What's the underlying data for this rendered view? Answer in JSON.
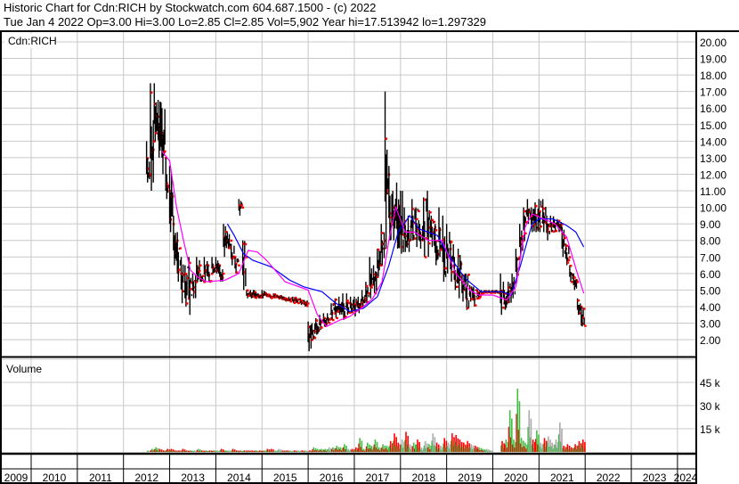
{
  "header": {
    "title": "Historic Chart for Cdn:RICH by Stockwatch.com 604.687.1500 - (c) 2022",
    "quote": "Tue Jan  4 2022  Op=3.00  Hi=3.00  Lo=2.85  Cl=2.85  Vol=5,902  Year hi=17.513942  lo=1.297329"
  },
  "price_panel": {
    "label": "Cdn:RICH"
  },
  "volume_panel": {
    "label": "Volume"
  },
  "colors": {
    "bar": "#000000",
    "close": "#ff0000",
    "ma_long": "#0000ff",
    "ma_short": "#ff00ff",
    "vol_up": "#44bb44",
    "vol_down": "#ff0000",
    "vol_flat": "#aaaaaa",
    "grid": "#c8c8c8"
  },
  "chart_data": {
    "type": "ohlc",
    "title": "Historic Chart for Cdn:RICH",
    "x_ticks": [
      "2009",
      "2010",
      "2011",
      "2012",
      "2013",
      "2014",
      "2015",
      "2016",
      "2017",
      "2018",
      "2019",
      "2020",
      "2021",
      "2022",
      "2023",
      "2024"
    ],
    "xlim": [
      2009.35,
      2024.4
    ],
    "y_ticks": [
      "20.00",
      "19.00",
      "18.00",
      "17.00",
      "16.00",
      "15.00",
      "14.00",
      "13.00",
      "12.00",
      "11.00",
      "10.00",
      "9.00",
      "8.00",
      "7.00",
      "6.00",
      "5.00",
      "4.00",
      "3.00",
      "2.00"
    ],
    "ylim": [
      1.0,
      20.6
    ],
    "volume_ticks": [
      "45 k",
      "30 k",
      "15 k"
    ],
    "volume_tick_values": [
      45,
      30,
      15
    ],
    "volume_unit": "thousands",
    "start": 2012.5,
    "step": "monthly",
    "high": [
      14,
      17.5,
      17.5,
      16.5,
      16,
      13,
      12.5,
      9.5,
      8.5,
      7,
      6.5,
      7,
      6,
      7,
      6,
      7,
      6.5,
      7,
      7,
      6.5,
      9,
      8.5,
      7.8,
      7,
      10.5,
      8,
      5,
      5,
      5,
      4.8,
      5,
      4.8,
      4.7,
      4.8,
      4.7,
      4.7,
      4.5,
      4.6,
      4.6,
      4.5,
      4.5,
      4.4,
      3.1,
      3,
      3.3,
      3.5,
      3.6,
      3.6,
      4.2,
      4.5,
      4.6,
      4.8,
      4.8,
      4.6,
      4.6,
      4.6,
      5,
      5.5,
      7,
      6.5,
      7.5,
      9,
      17,
      12.5,
      11,
      11.5,
      11,
      10,
      9.5,
      10.5,
      10,
      9,
      10.6,
      11,
      9.5,
      9,
      10,
      9.5,
      9,
      8,
      7,
      7.5,
      6,
      6,
      5.3,
      5.2,
      5,
      5,
      5,
      5,
      5,
      5,
      6,
      5,
      5.5,
      6,
      7.5,
      9,
      10,
      10.5,
      10,
      10.3,
      10.5,
      10.5,
      9.5,
      9.5,
      9.3,
      9.2,
      8.8,
      7.8,
      6.5,
      6,
      4.5,
      4
    ],
    "low": [
      11.5,
      11,
      14,
      13,
      12,
      10.5,
      8.5,
      6.5,
      5.5,
      4.2,
      4,
      3.5,
      4.5,
      5.5,
      5.5,
      5.5,
      5.5,
      6,
      6,
      5.5,
      7,
      7.5,
      6.5,
      6,
      9.5,
      5,
      4.5,
      4.5,
      4.5,
      4.5,
      4.5,
      4.6,
      4.5,
      4.5,
      4.5,
      4.4,
      4.3,
      4.3,
      4.2,
      4.2,
      4.1,
      4.0,
      1.3,
      2,
      2.3,
      2.6,
      2.8,
      3,
      3.2,
      3.3,
      3.5,
      3.2,
      3.5,
      3.6,
      3.4,
      3.6,
      4,
      4.2,
      4.5,
      4.8,
      5.8,
      6.5,
      7.5,
      8,
      8,
      7.5,
      7.2,
      7.3,
      7.3,
      8,
      7.6,
      7.5,
      7,
      7,
      7.6,
      6.5,
      7,
      5.5,
      6,
      5.5,
      5,
      4.5,
      4.3,
      3.8,
      4.3,
      4,
      4.5,
      4.8,
      4.8,
      4.8,
      4.8,
      4.8,
      3.5,
      3.8,
      4.2,
      4.5,
      5.5,
      7,
      8,
      9,
      8.5,
      8.5,
      8.5,
      8.5,
      8,
      8.5,
      8.5,
      8.5,
      7,
      6.5,
      5.5,
      5,
      3.5,
      2.8
    ],
    "close": [
      12,
      14,
      15.5,
      14.5,
      13,
      11,
      9,
      8,
      6,
      5.5,
      4.5,
      5.5,
      5.5,
      6.5,
      5.5,
      6.5,
      6,
      6.5,
      6.5,
      6,
      8,
      8,
      7,
      6.5,
      10,
      7,
      4.8,
      4.6,
      4.7,
      4.6,
      4.8,
      4.7,
      4.6,
      4.6,
      4.6,
      4.5,
      4.4,
      4.4,
      4.3,
      4.3,
      4.2,
      4.2,
      2,
      2.5,
      3,
      3.2,
      3.3,
      3.3,
      3.6,
      3.8,
      4,
      4.2,
      4.2,
      4.1,
      4,
      4.2,
      4.5,
      4.8,
      5.5,
      5.8,
      6.5,
      8,
      12,
      10,
      9.5,
      9,
      9,
      8.5,
      8.5,
      9,
      8.5,
      8.5,
      8.5,
      8.8,
      8.8,
      8,
      8,
      7.5,
      7.5,
      6.5,
      6,
      5.5,
      5,
      4.8,
      4.8,
      4.5,
      4.8,
      4.9,
      4.9,
      4.9,
      4.9,
      4.9,
      4.2,
      4.3,
      4.8,
      5.5,
      7,
      8,
      9.5,
      9.5,
      9,
      9.5,
      9.5,
      9,
      9,
      9,
      9,
      9,
      7.5,
      7,
      5.8,
      5.5,
      4,
      2.85
    ],
    "volume": [
      1,
      2,
      3,
      2,
      1,
      2,
      2,
      1,
      1,
      2,
      1,
      1,
      1,
      2,
      1,
      1,
      1,
      1,
      1,
      2,
      1,
      1,
      2,
      1,
      1,
      1,
      1,
      1,
      1,
      1,
      1,
      2,
      2,
      1,
      2,
      1,
      1,
      1,
      1,
      1,
      1,
      1,
      1,
      3,
      2,
      2,
      2,
      3,
      3,
      4,
      3,
      5,
      2,
      2,
      3,
      9,
      2,
      6,
      4,
      8,
      3,
      5,
      4,
      7,
      12,
      6,
      8,
      13,
      5,
      6,
      8,
      3,
      7,
      5,
      12,
      6,
      4,
      9,
      6,
      12,
      11,
      8,
      6,
      7,
      5,
      4,
      3,
      2,
      2,
      1,
      0,
      0,
      7,
      8,
      27,
      8,
      41,
      9,
      6,
      27,
      8,
      14,
      6,
      9,
      10,
      6,
      8,
      19,
      4,
      5,
      3,
      5,
      7,
      8
    ],
    "series": [
      {
        "name": "Moving average (long)",
        "color": "#0000ff",
        "points": [
          [
            2014.25,
            9
          ],
          [
            2014.4,
            8.3
          ],
          [
            2014.6,
            7.2
          ],
          [
            2014.8,
            6.8
          ],
          [
            2015.2,
            6.4
          ],
          [
            2015.6,
            5.6
          ],
          [
            2015.9,
            5.2
          ],
          [
            2016.3,
            4.9
          ],
          [
            2016.6,
            4.2
          ],
          [
            2016.9,
            3.7
          ],
          [
            2017.2,
            3.9
          ],
          [
            2017.5,
            4.6
          ],
          [
            2017.75,
            6.5
          ],
          [
            2017.95,
            8.5
          ],
          [
            2018.2,
            9.5
          ],
          [
            2018.4,
            8.7
          ],
          [
            2018.6,
            8.5
          ],
          [
            2018.8,
            8.3
          ],
          [
            2019.0,
            7.3
          ],
          [
            2019.4,
            5.7
          ],
          [
            2019.75,
            4.9
          ],
          [
            2020.2,
            4.9
          ],
          [
            2020.4,
            4.7
          ],
          [
            2020.6,
            6.5
          ],
          [
            2020.85,
            9.0
          ],
          [
            2021.0,
            9.3
          ],
          [
            2021.3,
            9.3
          ],
          [
            2021.6,
            8.9
          ],
          [
            2021.8,
            8.5
          ],
          [
            2021.97,
            7.6
          ]
        ]
      },
      {
        "name": "Moving average (short)",
        "color": "#ff00ff",
        "points": [
          [
            2012.83,
            13.4
          ],
          [
            2013.0,
            12.8
          ],
          [
            2013.15,
            10
          ],
          [
            2013.3,
            8
          ],
          [
            2013.45,
            6.2
          ],
          [
            2013.6,
            5.8
          ],
          [
            2013.8,
            5.5
          ],
          [
            2014.2,
            5.6
          ],
          [
            2014.5,
            6
          ],
          [
            2014.7,
            7.4
          ],
          [
            2014.9,
            7.3
          ],
          [
            2015.1,
            6.8
          ],
          [
            2015.5,
            5.5
          ],
          [
            2015.8,
            5.2
          ],
          [
            2016.0,
            5.0
          ],
          [
            2016.2,
            3.5
          ],
          [
            2016.4,
            2.8
          ],
          [
            2016.7,
            3.2
          ],
          [
            2016.9,
            3.4
          ],
          [
            2017.2,
            4.0
          ],
          [
            2017.4,
            4.5
          ],
          [
            2017.6,
            5.5
          ],
          [
            2017.75,
            8
          ],
          [
            2017.9,
            10
          ],
          [
            2018.1,
            8.5
          ],
          [
            2018.3,
            8.5
          ],
          [
            2018.6,
            8
          ],
          [
            2018.9,
            8
          ],
          [
            2019.2,
            6
          ],
          [
            2019.5,
            5
          ],
          [
            2019.7,
            4.7
          ],
          [
            2020.0,
            4.7
          ],
          [
            2020.3,
            4.4
          ],
          [
            2020.5,
            5.2
          ],
          [
            2020.7,
            8.8
          ],
          [
            2020.85,
            9.6
          ],
          [
            2021.1,
            9.3
          ],
          [
            2021.35,
            9.0
          ],
          [
            2021.6,
            8.2
          ],
          [
            2021.8,
            6.3
          ],
          [
            2021.97,
            4.8
          ]
        ]
      }
    ]
  }
}
